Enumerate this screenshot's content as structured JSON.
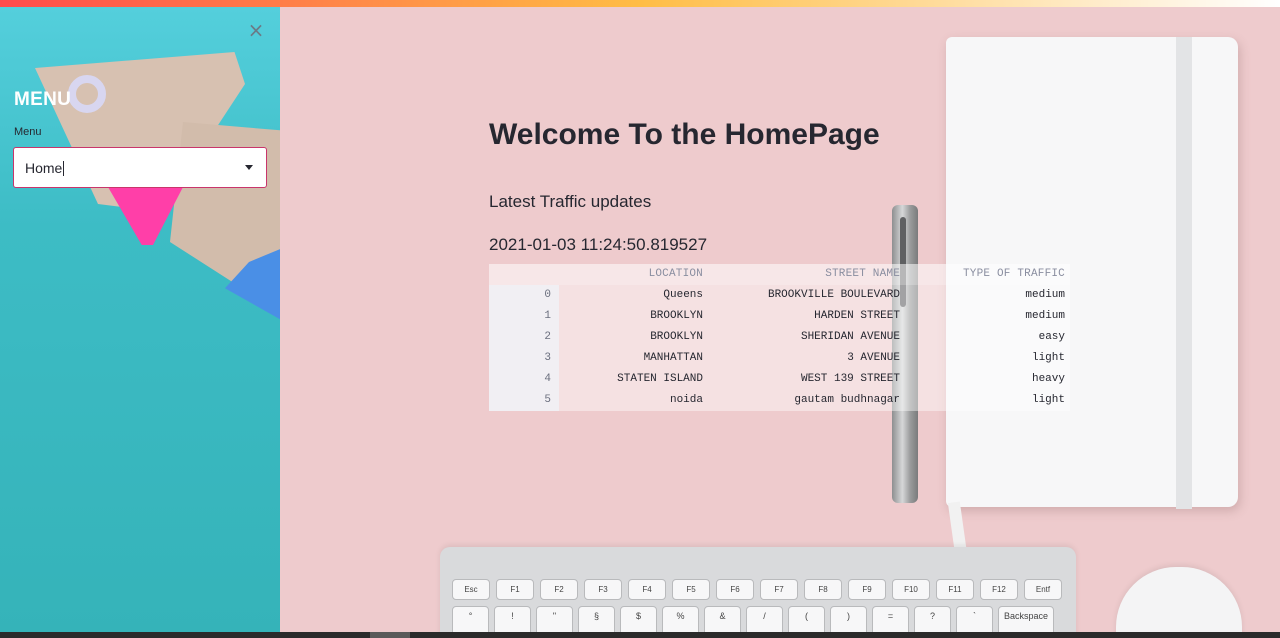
{
  "sidebar": {
    "title": "MENU",
    "select_label": "Menu",
    "select_value": "Home"
  },
  "main": {
    "title": "Welcome To the HomePage",
    "subheader": "Latest Traffic updates",
    "timestamp": "2021-01-03 11:24:50.819527",
    "table": {
      "columns": [
        "",
        "LOCATION",
        "STREET NAME",
        "TYPE OF TRAFFIC"
      ],
      "rows": [
        {
          "index": "0",
          "location": "Queens",
          "street": "BROOKVILLE BOULEVARD",
          "type": "medium"
        },
        {
          "index": "1",
          "location": "BROOKLYN",
          "street": "HARDEN STREET",
          "type": "medium"
        },
        {
          "index": "2",
          "location": "BROOKLYN",
          "street": "SHERIDAN AVENUE",
          "type": "easy"
        },
        {
          "index": "3",
          "location": "MANHATTAN",
          "street": "3 AVENUE",
          "type": "light"
        },
        {
          "index": "4",
          "location": "STATEN ISLAND",
          "street": "WEST 139 STREET",
          "type": "heavy"
        },
        {
          "index": "5",
          "location": "noida",
          "street": "gautam budhnagar",
          "type": "light"
        }
      ]
    }
  },
  "keyboard": {
    "top_row": [
      "Esc",
      "F1",
      "F2",
      "F3",
      "F4",
      "F5",
      "F6",
      "F7",
      "F8",
      "F9",
      "F10",
      "F11",
      "F12",
      "Entf"
    ],
    "bottom_row": [
      "°",
      "!",
      "\"",
      "§",
      "$",
      "%",
      "&",
      "/",
      "(",
      ")",
      "=",
      "?",
      "`",
      "Backspace"
    ]
  },
  "colors": {
    "sidebar": "#3dbcc5",
    "background": "#eecbcd",
    "accent": "#c9356b",
    "text": "#262730"
  }
}
